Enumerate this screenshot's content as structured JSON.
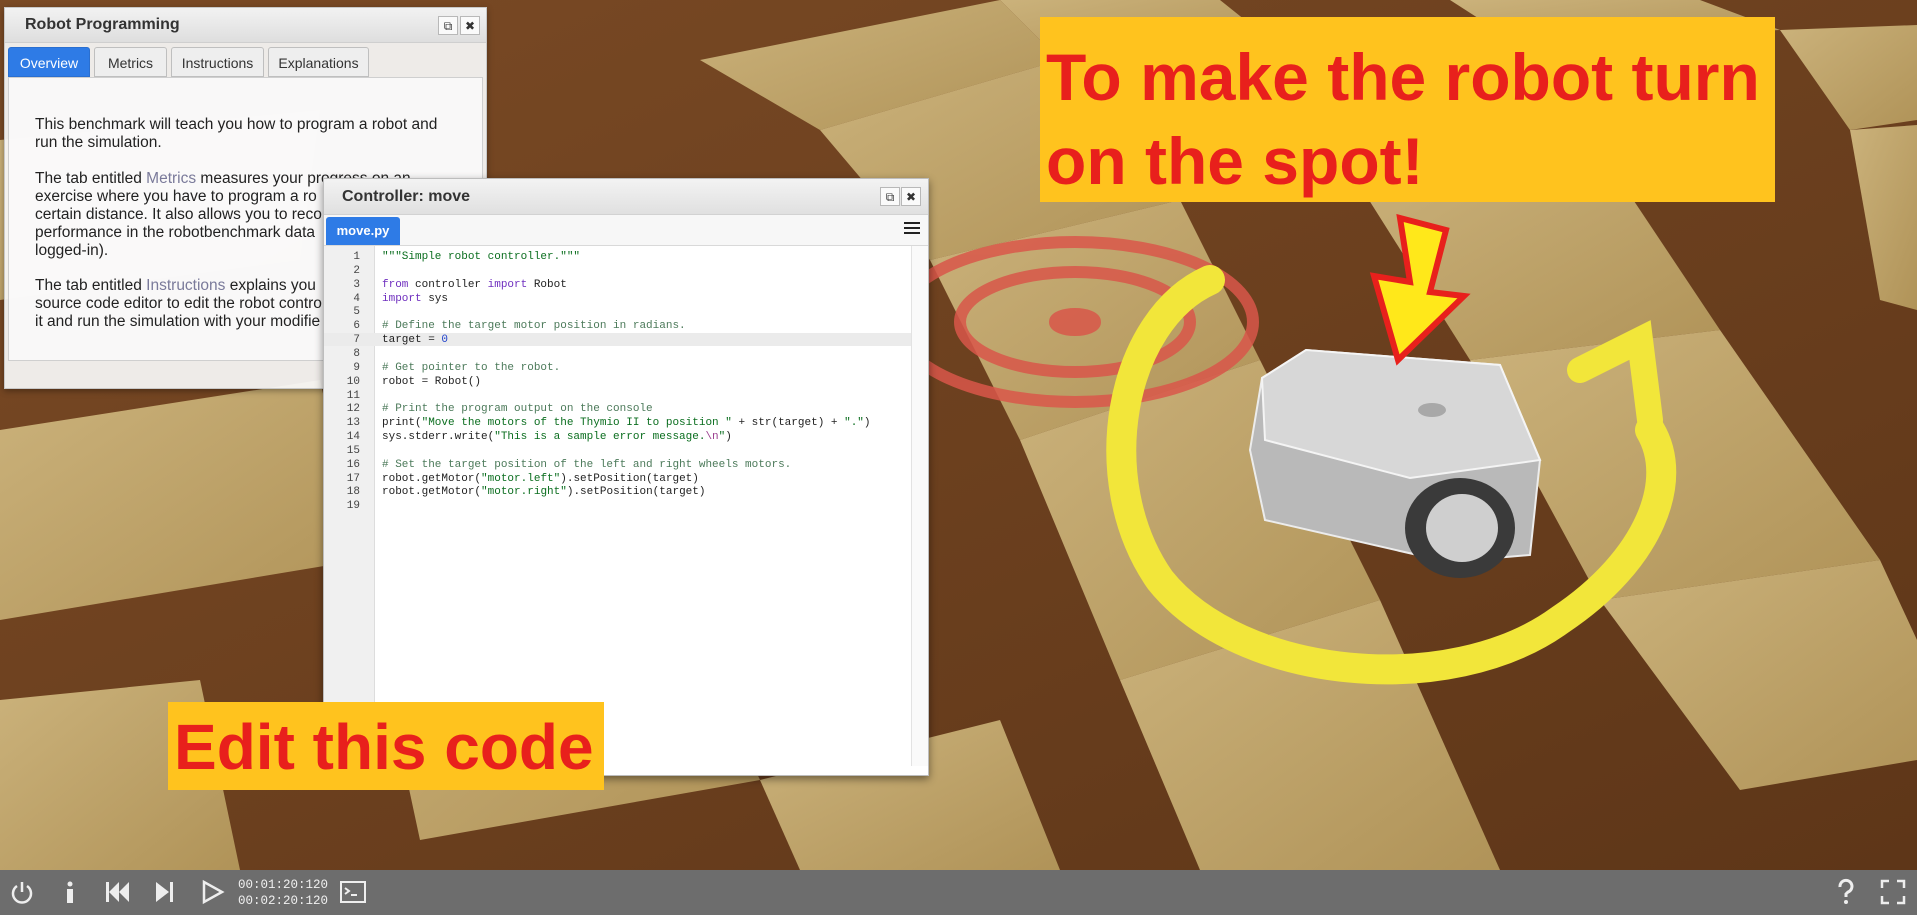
{
  "robot_programming": {
    "title": "Robot Programming",
    "tabs": [
      "Overview",
      "Metrics",
      "Instructions",
      "Explanations"
    ],
    "active_tab": "Overview",
    "paragraphs": [
      {
        "lines": [
          "This benchmark will teach you how to program a robot and",
          "run the simulation."
        ]
      },
      {
        "prefix": "The tab entitled ",
        "link": "Metrics",
        "lines_after": [
          " measures your progress on an",
          "exercise where you have to program a ro",
          "certain distance. It also allows you to reco",
          "performance in the robotbenchmark data",
          "logged-in)."
        ]
      },
      {
        "prefix": "The tab entitled ",
        "link": "Instructions",
        "lines_after": [
          " explains you",
          "source code editor to edit the robot contro",
          "it and run the simulation with your modifie"
        ]
      }
    ]
  },
  "controller": {
    "title": "Controller: move",
    "file_tab": "move.py",
    "code_lines": [
      "\"\"\"Simple robot controller.\"\"\"",
      "",
      "from controller import Robot",
      "import sys",
      "",
      "# Define the target motor position in radians.",
      "target = 0",
      "",
      "# Get pointer to the robot.",
      "robot = Robot()",
      "",
      "# Print the program output on the console",
      "print(\"Move the motors of the Thymio II to position \" + str(target) + \".\")",
      "sys.stderr.write(\"This is a sample error message.\\n\")",
      "",
      "# Set the target position of the left and right wheels motors.",
      "robot.getMotor(\"motor.left\").setPosition(target)",
      "robot.getMotor(\"motor.right\").setPosition(target)",
      ""
    ],
    "active_line": 7
  },
  "annotations": {
    "top_line1": "To make the robot turn",
    "top_line2": "on the spot!",
    "bottom": "Edit this code"
  },
  "toolbar": {
    "time_elapsed": "00:01:20:120",
    "time_total": "00:02:20:120",
    "icons": [
      "power-icon",
      "info-icon",
      "reset-icon",
      "step-icon",
      "play-icon",
      "console-icon",
      "help-icon",
      "fullscreen-icon"
    ]
  },
  "colors": {
    "accent_blue": "#2e7be6",
    "callout_yellow": "#ffc31e",
    "callout_red": "#e8201c",
    "arrow_yellow": "#ffe81a",
    "toolbar_gray": "#6d6d6d"
  }
}
